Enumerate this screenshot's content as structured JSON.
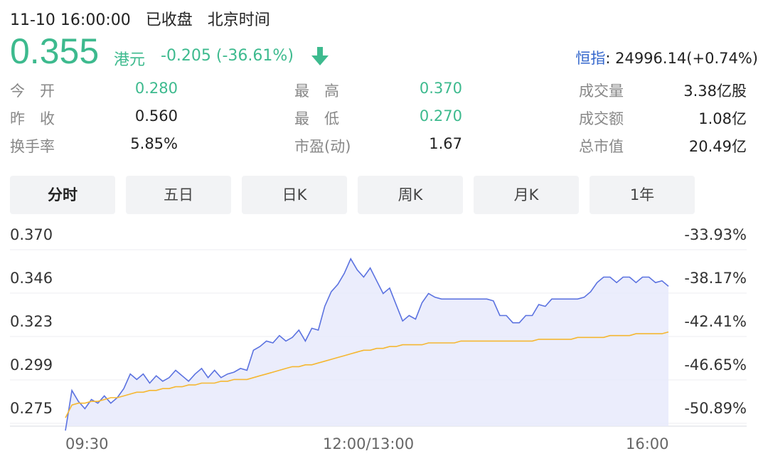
{
  "status": {
    "datetime": "11-10 16:00:00",
    "state": "已收盘",
    "timezone": "北京时间"
  },
  "quote": {
    "price": "0.355",
    "currency": "港元",
    "change": "-0.205 (-36.61%)",
    "direction_icon": "arrow-down-icon",
    "color_down": "#3dba8e"
  },
  "index": {
    "name": "恒指",
    "value": ": 24996.14(+0.74%)"
  },
  "stats": {
    "col1": [
      {
        "label": "今　开",
        "value": "0.280",
        "green": true
      },
      {
        "label": "昨　收",
        "value": "0.560",
        "green": false
      },
      {
        "label": "换手率",
        "value": "5.85%",
        "green": false
      }
    ],
    "col2": [
      {
        "label": "最　高",
        "value": "0.370",
        "green": true
      },
      {
        "label": "最　低",
        "value": "0.270",
        "green": true
      },
      {
        "label": "市盈(动)",
        "value": "1.67",
        "green": false
      }
    ],
    "col3": [
      {
        "label": "成交量",
        "value": "3.38亿股"
      },
      {
        "label": "成交额",
        "value": "1.08亿"
      },
      {
        "label": "总市值",
        "value": "20.49亿"
      }
    ]
  },
  "tabs": [
    {
      "label": "分时",
      "active": true
    },
    {
      "label": "五日",
      "active": false
    },
    {
      "label": "日K",
      "active": false
    },
    {
      "label": "周K",
      "active": false
    },
    {
      "label": "月K",
      "active": false
    },
    {
      "label": "1年",
      "active": false
    }
  ],
  "chart_data": {
    "type": "line",
    "y_ticks": [
      "0.370",
      "0.346",
      "0.323",
      "0.299",
      "0.275"
    ],
    "y_pct_ticks": [
      "-33.93%",
      "-38.17%",
      "-42.41%",
      "-46.65%",
      "-50.89%"
    ],
    "ylim": [
      0.275,
      0.37
    ],
    "x_ticks": [
      "09:30",
      "12:00/13:00",
      "16:00"
    ],
    "grid": true,
    "colors": {
      "price": "#5b72e0",
      "avg": "#f5b731",
      "fill": "#e6e9fb"
    },
    "series": [
      {
        "values": [
          0.271,
          0.293,
          0.287,
          0.283,
          0.288,
          0.286,
          0.29,
          0.286,
          0.289,
          0.294,
          0.302,
          0.299,
          0.302,
          0.297,
          0.301,
          0.298,
          0.3,
          0.304,
          0.301,
          0.298,
          0.302,
          0.305,
          0.3,
          0.304,
          0.3,
          0.302,
          0.303,
          0.305,
          0.304,
          0.315,
          0.317,
          0.32,
          0.319,
          0.323,
          0.32,
          0.322,
          0.326,
          0.32,
          0.327,
          0.326,
          0.339,
          0.347,
          0.351,
          0.357,
          0.365,
          0.359,
          0.355,
          0.36,
          0.353,
          0.346,
          0.349,
          0.34,
          0.331,
          0.334,
          0.332,
          0.341,
          0.346,
          0.344,
          0.343,
          0.343,
          0.343,
          0.343,
          0.343,
          0.343,
          0.343,
          0.343,
          0.342,
          0.334,
          0.334,
          0.33,
          0.33,
          0.334,
          0.334,
          0.34,
          0.339,
          0.343,
          0.343,
          0.343,
          0.343,
          0.343,
          0.344,
          0.347,
          0.352,
          0.355,
          0.355,
          0.352,
          0.355,
          0.355,
          0.352,
          0.355,
          0.355,
          0.352,
          0.353,
          0.35
        ]
      },
      {
        "values": [
          0.278,
          0.285,
          0.286,
          0.286,
          0.287,
          0.287,
          0.288,
          0.289,
          0.289,
          0.29,
          0.291,
          0.292,
          0.292,
          0.293,
          0.293,
          0.294,
          0.294,
          0.295,
          0.295,
          0.296,
          0.296,
          0.297,
          0.297,
          0.297,
          0.298,
          0.298,
          0.299,
          0.299,
          0.299,
          0.3,
          0.301,
          0.302,
          0.303,
          0.304,
          0.305,
          0.306,
          0.306,
          0.307,
          0.307,
          0.308,
          0.309,
          0.31,
          0.311,
          0.312,
          0.313,
          0.314,
          0.315,
          0.315,
          0.316,
          0.316,
          0.317,
          0.317,
          0.318,
          0.318,
          0.318,
          0.318,
          0.319,
          0.319,
          0.319,
          0.319,
          0.319,
          0.32,
          0.32,
          0.32,
          0.32,
          0.32,
          0.32,
          0.32,
          0.32,
          0.32,
          0.32,
          0.32,
          0.32,
          0.321,
          0.321,
          0.321,
          0.321,
          0.321,
          0.321,
          0.322,
          0.322,
          0.322,
          0.322,
          0.322,
          0.323,
          0.323,
          0.323,
          0.323,
          0.324,
          0.324,
          0.324,
          0.324,
          0.324,
          0.325
        ]
      }
    ]
  }
}
